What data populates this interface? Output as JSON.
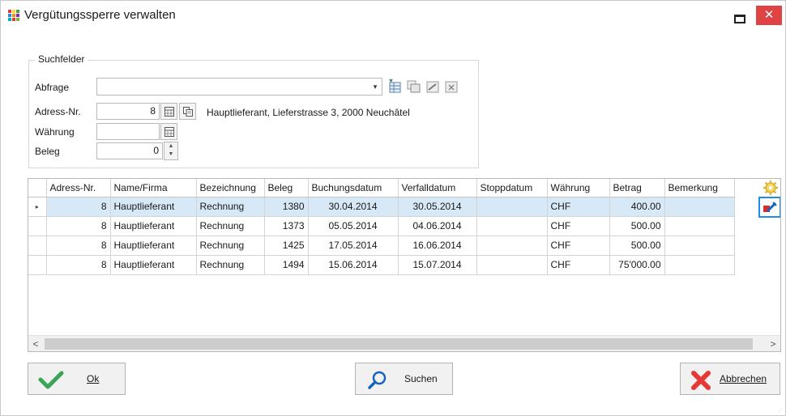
{
  "window": {
    "title": "Vergütungssperre verwalten",
    "minimize_glyph": "▭",
    "close_glyph": "✕",
    "accent_close": "#e04343"
  },
  "search": {
    "legend": "Suchfelder",
    "abfrage_label": "Abfrage",
    "abfrage_value": "",
    "adress_label": "Adress-Nr.",
    "adress_value": "8",
    "adress_text": "Hauptlieferant, Lieferstrasse 3, 2000 Neuchâtel",
    "waehrung_label": "Währung",
    "waehrung_value": "",
    "beleg_label": "Beleg",
    "beleg_value": "0",
    "combo_arrow": "▾",
    "spin_up": "▲",
    "spin_down": "▼"
  },
  "grid": {
    "columns": [
      "Adress-Nr.",
      "Name/Firma",
      "Bezeichnung",
      "Beleg",
      "Buchungsdatum",
      "Verfalldatum",
      "Stoppdatum",
      "Währung",
      "Betrag",
      "Bemerkung"
    ],
    "rows": [
      {
        "adress": "8",
        "name": "Hauptlieferant",
        "bez": "Rechnung",
        "beleg": "1380",
        "buch": "30.04.2014",
        "verf": "30.05.2014",
        "stopp": "",
        "waehr": "CHF",
        "betrag": "400.00",
        "bem": ""
      },
      {
        "adress": "8",
        "name": "Hauptlieferant",
        "bez": "Rechnung",
        "beleg": "1373",
        "buch": "05.05.2014",
        "verf": "04.06.2014",
        "stopp": "",
        "waehr": "CHF",
        "betrag": "500.00",
        "bem": ""
      },
      {
        "adress": "8",
        "name": "Hauptlieferant",
        "bez": "Rechnung",
        "beleg": "1425",
        "buch": "17.05.2014",
        "verf": "16.06.2014",
        "stopp": "",
        "waehr": "CHF",
        "betrag": "500.00",
        "bem": ""
      },
      {
        "adress": "8",
        "name": "Hauptlieferant",
        "bez": "Rechnung",
        "beleg": "1494",
        "buch": "15.06.2014",
        "verf": "15.07.2014",
        "stopp": "",
        "waehr": "CHF",
        "betrag": "75'000.00",
        "bem": ""
      }
    ],
    "row_indicator": "▸",
    "scroll_left": "<",
    "scroll_right": ">",
    "selection_color": "#d7e8f6"
  },
  "buttons": {
    "ok_label": "Ok",
    "suchen_label": "Suchen",
    "abbrechen_label": "Abbrechen"
  },
  "icons": {
    "app": "app-grid-icon",
    "calendar": "calendar-icon",
    "copy": "copy-icon",
    "gear": "gear-icon",
    "edit": "edit-row-icon",
    "ok": "checkmark-icon",
    "search": "magnifier-icon",
    "cancel": "red-x-icon"
  }
}
